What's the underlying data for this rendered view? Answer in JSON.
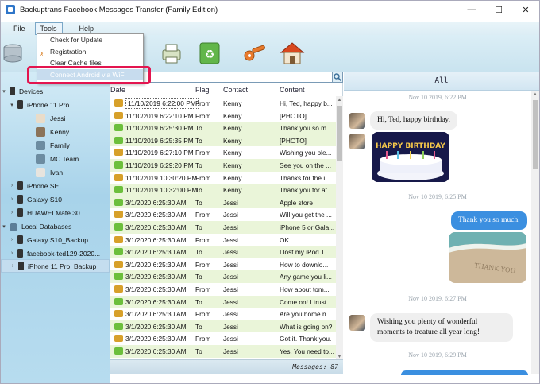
{
  "window": {
    "title": "Backuptrans Facebook Messages Transfer (Family Edition)",
    "minimize": "—",
    "maximize": "☐",
    "close": "✕"
  },
  "menu": {
    "file": "File",
    "tools": "Tools",
    "help": "Help"
  },
  "tools_menu": {
    "items": [
      "Check for Update",
      "Registration",
      "Clear Cache files",
      "Connect Android via WiFi"
    ]
  },
  "toolbar": {
    "buttons": [
      "database-icon",
      "print-icon",
      "recycle-icon",
      "key-icon",
      "home-icon"
    ]
  },
  "sidebar": {
    "devices_label": "Devices",
    "device_main": "iPhone 11 Pro",
    "contacts": [
      "Jessi",
      "Kenny",
      "Family",
      "MC Team",
      "Ivan"
    ],
    "other_devices": [
      "iPhone SE",
      "Galaxy S10",
      "HUAWEI Mate 30"
    ],
    "local_db_label": "Local Databases",
    "databases": [
      "Galaxy S10_Backup",
      "facebook-ted129-2020...",
      "iPhone 11 Pro_Backup"
    ]
  },
  "list": {
    "headers": {
      "date": "Date",
      "flag": "Flag",
      "contact": "Contact",
      "content": "Content"
    },
    "rows": [
      {
        "dir": "in",
        "date": "11/10/2019 6:22:00 PM",
        "flag": "From",
        "contact": "Kenny",
        "content": "Hi, Ted, happy b..."
      },
      {
        "dir": "in",
        "date": "11/10/2019 6:22:10 PM",
        "flag": "From",
        "contact": "Kenny",
        "content": "[PHOTO]"
      },
      {
        "dir": "out",
        "date": "11/10/2019 6:25:30 PM",
        "flag": "To",
        "contact": "Kenny",
        "content": "Thank you so m..."
      },
      {
        "dir": "out",
        "date": "11/10/2019 6:25:35 PM",
        "flag": "To",
        "contact": "Kenny",
        "content": "[PHOTO]"
      },
      {
        "dir": "in",
        "date": "11/10/2019 6:27:10 PM",
        "flag": "From",
        "contact": "Kenny",
        "content": "Wishing you ple..."
      },
      {
        "dir": "out",
        "date": "11/10/2019 6:29:20 PM",
        "flag": "To",
        "contact": "Kenny",
        "content": "See you on the ..."
      },
      {
        "dir": "in",
        "date": "11/10/2019 10:30:20 PM",
        "flag": "From",
        "contact": "Kenny",
        "content": "Thanks for the i..."
      },
      {
        "dir": "out",
        "date": "11/10/2019 10:32:00 PM",
        "flag": "To",
        "contact": "Kenny",
        "content": "Thank you for at..."
      },
      {
        "dir": "out",
        "date": "3/1/2020 6:25:30 AM",
        "flag": "To",
        "contact": "Jessi",
        "content": "Apple store"
      },
      {
        "dir": "in",
        "date": "3/1/2020 6:25:30 AM",
        "flag": "From",
        "contact": "Jessi",
        "content": "Will you get the ..."
      },
      {
        "dir": "out",
        "date": "3/1/2020 6:25:30 AM",
        "flag": "To",
        "contact": "Jessi",
        "content": "iPhone 5 or Gala..."
      },
      {
        "dir": "in",
        "date": "3/1/2020 6:25:30 AM",
        "flag": "From",
        "contact": "Jessi",
        "content": "OK."
      },
      {
        "dir": "out",
        "date": "3/1/2020 6:25:30 AM",
        "flag": "To",
        "contact": "Jessi",
        "content": "I lost my iPod T..."
      },
      {
        "dir": "in",
        "date": "3/1/2020 6:25:30 AM",
        "flag": "From",
        "contact": "Jessi",
        "content": "How to downlo..."
      },
      {
        "dir": "out",
        "date": "3/1/2020 6:25:30 AM",
        "flag": "To",
        "contact": "Jessi",
        "content": "Any game you li..."
      },
      {
        "dir": "in",
        "date": "3/1/2020 6:25:30 AM",
        "flag": "From",
        "contact": "Jessi",
        "content": "How about tom..."
      },
      {
        "dir": "out",
        "date": "3/1/2020 6:25:30 AM",
        "flag": "To",
        "contact": "Jessi",
        "content": "Come on! I trust..."
      },
      {
        "dir": "in",
        "date": "3/1/2020 6:25:30 AM",
        "flag": "From",
        "contact": "Jessi",
        "content": "Are you home n..."
      },
      {
        "dir": "out",
        "date": "3/1/2020 6:25:30 AM",
        "flag": "To",
        "contact": "Jessi",
        "content": "What is going on?"
      },
      {
        "dir": "in",
        "date": "3/1/2020 6:25:30 AM",
        "flag": "From",
        "contact": "Jessi",
        "content": "Got it. Thank you."
      },
      {
        "dir": "out",
        "date": "3/1/2020 6:25:30 AM",
        "flag": "To",
        "contact": "Jessi",
        "content": "Yes. You need to..."
      }
    ],
    "footer": "Messages: 87"
  },
  "conversation": {
    "header": "All",
    "ts1": "Nov 10 2019, 6:22 PM",
    "msg1": "Hi, Ted, happy birthday.",
    "photo_text": "HAPPY BIRTHDAY",
    "ts2": "Nov 10 2019, 6:25 PM",
    "msg2": "Thank you so much.",
    "sand_text": "THANK YOU",
    "ts3": "Nov 10 2019, 6:27 PM",
    "msg3_line1": "Wishing you plenty of wonderful",
    "msg3_line2": "moments to treature all year long!",
    "ts4": "Nov 10 2019, 6:29 PM"
  }
}
